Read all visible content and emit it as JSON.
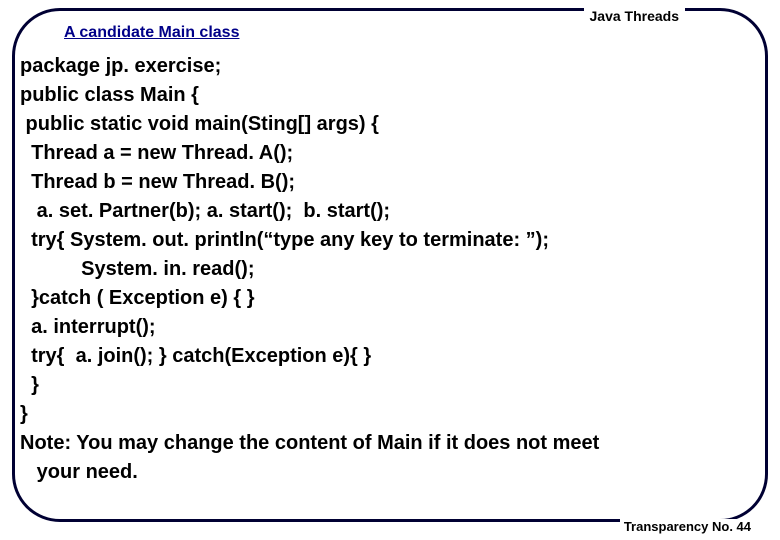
{
  "header": "Java Threads",
  "title": "A candidate Main class",
  "code": {
    "l1": "package jp. exercise;",
    "l2": "public class Main {",
    "l3": " public static void main(Sting[] args) {",
    "l4": "  Thread a = new Thread. A();",
    "l5": "  Thread b = new Thread. B();",
    "l6": "   a. set. Partner(b); a. start();  b. start();",
    "l7": "  try{ System. out. println(“type any key to terminate: ”);",
    "l8": "           System. in. read();",
    "l9": "  }catch ( Exception e) { }",
    "l10": "  a. interrupt();",
    "l11": "  try{  a. join(); } catch(Exception e){ }",
    "l12": "  }",
    "l13": "}",
    "l14": "Note: You may change the content of Main if it does not meet",
    "l15": "   your need."
  },
  "footer": "Transparency No. 44"
}
